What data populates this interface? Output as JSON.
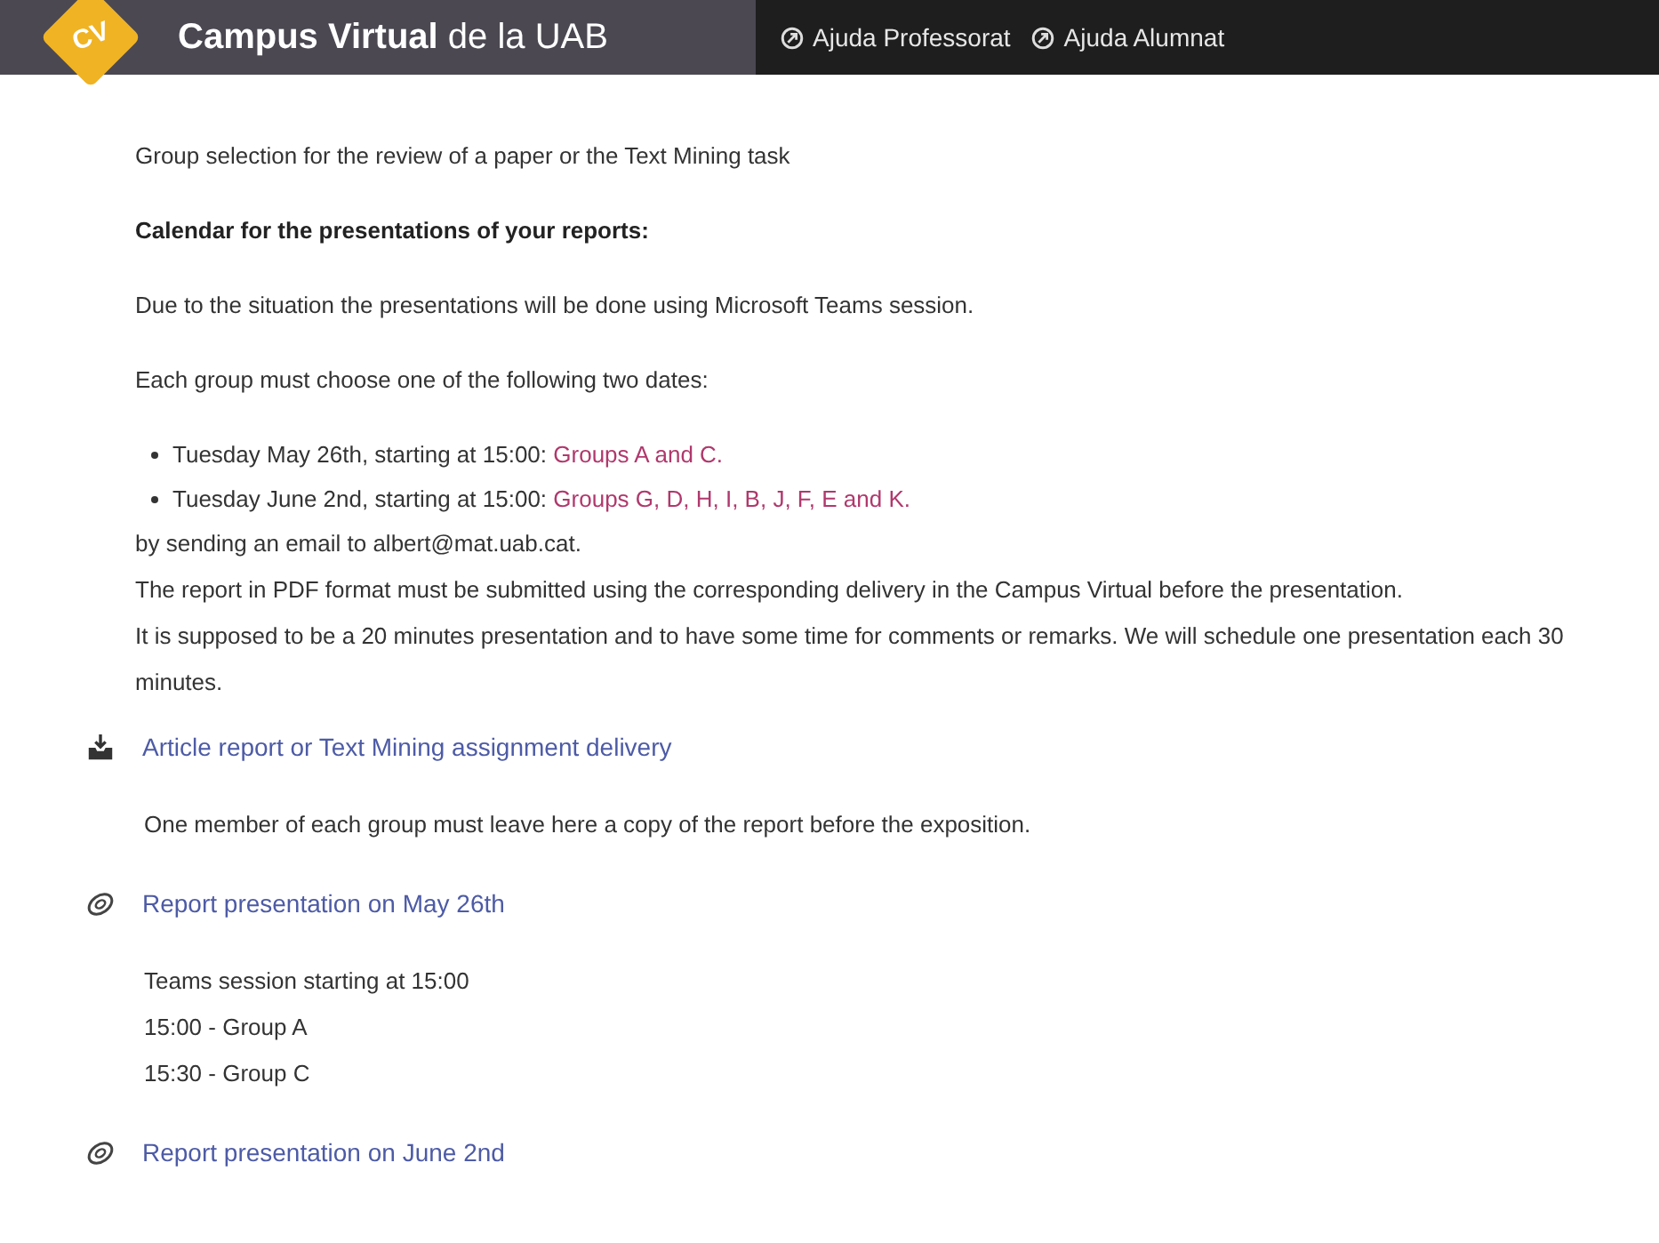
{
  "header": {
    "logo": "CV",
    "title": "**Campus Virtual** de la UAB",
    "links": [
      "Ajuda Professorat",
      "Ajuda Alumnat"
    ]
  },
  "intro": [
    {
      "kind": "text",
      "text": "Group selection for the review of a paper or the Text Mining task"
    },
    {
      "kind": "heading",
      "text": "Calendar for the presentations of your reports:"
    },
    {
      "kind": "text",
      "text": "Due to the situation the presentations will be done using Microsoft Teams session."
    },
    {
      "kind": "text",
      "text": "Each group must choose one of the following two dates:"
    },
    {
      "kind": "bullets",
      "items": [
        {
          "text": "Tuesday May 26th, starting at 15:00:",
          "highlight": "Groups A and C."
        },
        {
          "text": "Tuesday June 2nd, starting at 15:00:",
          "highlight": "Groups G, D, H, I, B, J, F, E and K."
        }
      ]
    },
    {
      "kind": "lines",
      "lines": [
        "by sending an email to albert@mat.uab.cat.",
        "The report in PDF format must be submitted using the corresponding delivery in the Campus Virtual before the presentation.",
        "It is supposed to be a 20 minutes presentation and to have some time for comments or remarks. We will schedule one presentation each 30 minutes."
      ]
    }
  ],
  "activities": [
    {
      "kind": "assignment",
      "title": "Article report or Text Mining assignment delivery",
      "lines": [
        "One member of each group must leave here a copy of the report before the exposition."
      ]
    },
    {
      "kind": "url",
      "title": "Report presentation on May 26th",
      "lines": [
        "Teams session starting at 15:00",
        "15:00 - Group A",
        "15:30 - Group C"
      ]
    },
    {
      "kind": "url",
      "title": "Report presentation on June 2nd"
    }
  ]
}
